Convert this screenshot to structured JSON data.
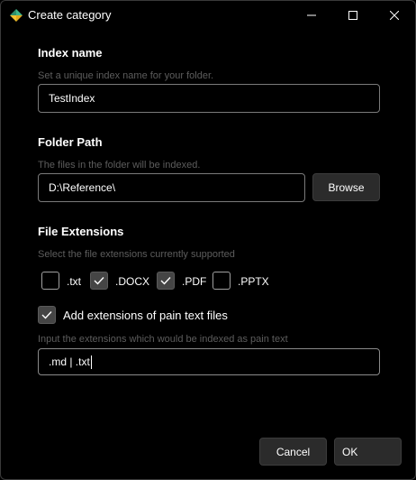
{
  "window": {
    "title": "Create category"
  },
  "index_name": {
    "heading": "Index name",
    "hint": "Set a unique index name for your folder.",
    "value": "TestIndex"
  },
  "folder_path": {
    "heading": "Folder Path",
    "hint": "The files in the folder will be indexed.",
    "value": "D:\\Reference\\",
    "browse_label": "Browse"
  },
  "file_extensions": {
    "heading": "File Extensions",
    "hint": "Select the file extensions currently supported",
    "options": [
      {
        "label": ".txt",
        "checked": false
      },
      {
        "label": ".DOCX",
        "checked": true
      },
      {
        "label": ".PDF",
        "checked": true
      },
      {
        "label": ".PPTX",
        "checked": false
      }
    ],
    "plain_text_toggle": {
      "label": "Add extensions of pain text files",
      "checked": true
    },
    "plain_text_hint": "Input the extensions which would be indexed as pain text",
    "plain_text_value": ".md | .txt"
  },
  "footer": {
    "cancel_label": "Cancel",
    "ok_label": "OK"
  },
  "colors": {
    "background": "#000000",
    "control": "#2b2b2b",
    "checked_box": "#454545",
    "hint_text": "#5d5d5d",
    "app_icon_green": "#3fb58a",
    "app_icon_yellow": "#f2c230"
  },
  "icons": {
    "app": "app-logo-icon",
    "minimize": "minimize-icon",
    "maximize": "maximize-icon",
    "close": "close-icon",
    "check": "check-icon"
  }
}
